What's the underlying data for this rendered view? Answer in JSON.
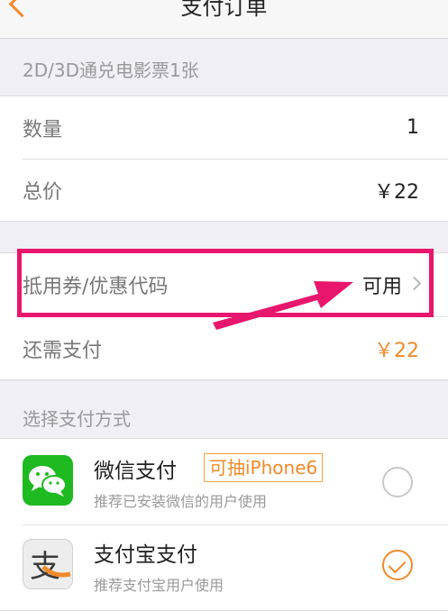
{
  "nav": {
    "title": "支付订单"
  },
  "product": {
    "name": "2D/3D通兑电影票1张"
  },
  "order": {
    "quantity_label": "数量",
    "quantity_value": "1",
    "total_label": "总价",
    "total_value": "￥22"
  },
  "discount": {
    "coupon_label": "抵用券/优惠代码",
    "coupon_value": "可用",
    "remaining_label": "还需支付",
    "remaining_value": "￥22"
  },
  "payment": {
    "header": "选择支付方式",
    "methods": [
      {
        "title": "微信支付",
        "badge": "可抽iPhone6",
        "subtitle": "推荐已安装微信的用户使用",
        "icon": "wechat-icon",
        "selected": false
      },
      {
        "title": "支付宝支付",
        "subtitle": "推荐支付宝用户使用",
        "icon": "alipay-icon",
        "selected": true
      }
    ]
  },
  "colors": {
    "accent": "#f08a2b",
    "highlight": "#e8166d",
    "wechat_green": "#1fb922"
  }
}
